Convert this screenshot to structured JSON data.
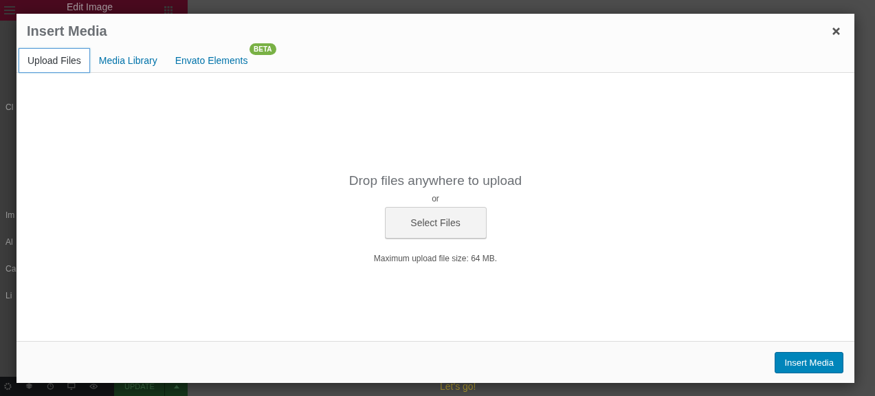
{
  "editor": {
    "panel_title": "Edit Image",
    "panel_labels": [
      "Cl",
      "Im",
      "Al",
      "Ca",
      "Li"
    ],
    "update_button": "UPDATE",
    "page_button": "Let's go!"
  },
  "modal": {
    "title": "Insert Media",
    "tabs": [
      {
        "label": "Upload Files",
        "selected": true
      },
      {
        "label": "Media Library",
        "selected": false
      },
      {
        "label": "Envato Elements",
        "selected": false,
        "badge": "BETA"
      }
    ],
    "upload": {
      "heading": "Drop files anywhere to upload",
      "or": "or",
      "button": "Select Files",
      "max_size": "Maximum upload file size: 64 MB."
    },
    "footer_button": "Insert Media"
  }
}
